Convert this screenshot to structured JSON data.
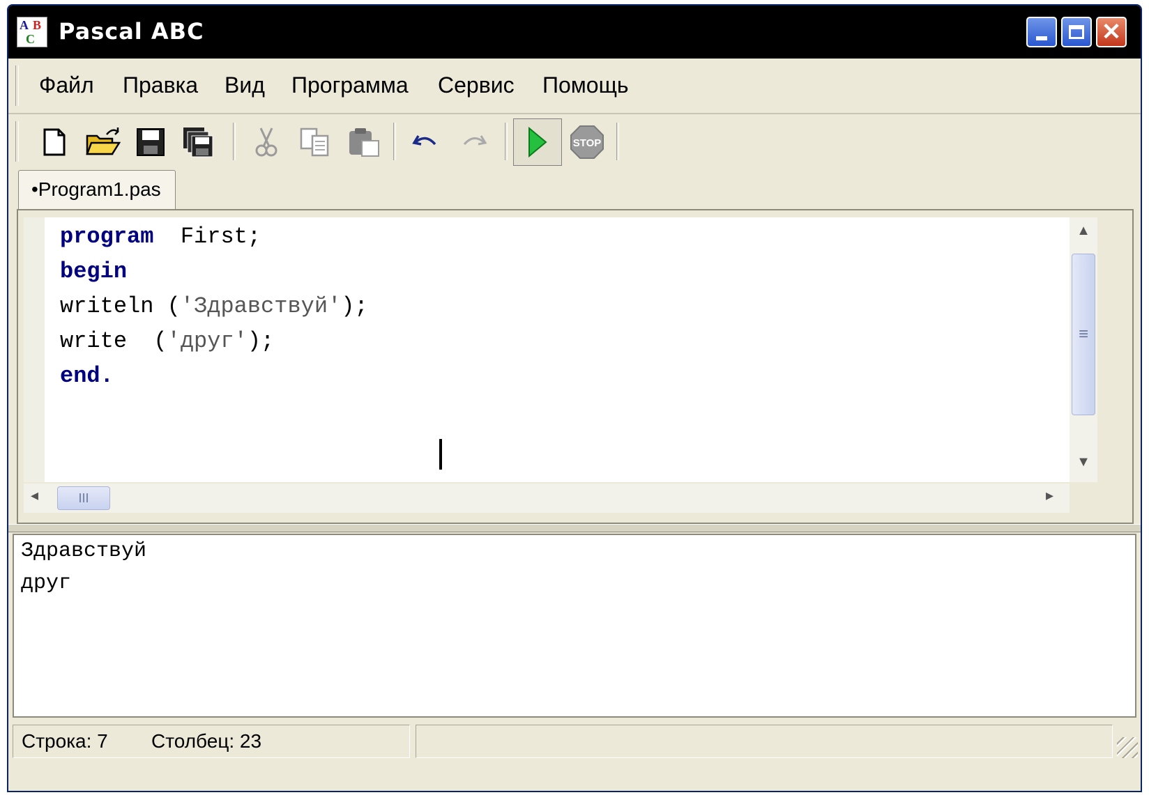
{
  "window": {
    "title": "Pascal ABC",
    "icon_letters": [
      "A",
      "B",
      "C"
    ]
  },
  "menu": {
    "items": [
      "Файл",
      "Правка",
      "Вид",
      "Программа",
      "Сервис",
      "Помощь"
    ]
  },
  "toolbar": {
    "buttons": [
      {
        "name": "new-file",
        "icon": "new-file-icon",
        "enabled": true
      },
      {
        "name": "open-file",
        "icon": "open-folder-icon",
        "enabled": true
      },
      {
        "name": "save",
        "icon": "save-icon",
        "enabled": true
      },
      {
        "name": "save-all",
        "icon": "save-all-icon",
        "enabled": true
      },
      {
        "name": "cut",
        "icon": "scissors-icon",
        "enabled": false
      },
      {
        "name": "copy",
        "icon": "copy-icon",
        "enabled": false
      },
      {
        "name": "paste",
        "icon": "paste-icon",
        "enabled": false
      },
      {
        "name": "undo",
        "icon": "undo-icon",
        "enabled": true
      },
      {
        "name": "redo",
        "icon": "redo-icon",
        "enabled": false
      },
      {
        "name": "run",
        "icon": "play-icon",
        "enabled": true
      },
      {
        "name": "stop",
        "icon": "stop-icon",
        "enabled": false
      }
    ],
    "stop_label": "STOP"
  },
  "tabs": [
    {
      "label": "•Program1.pas",
      "active": true
    }
  ],
  "editor": {
    "lines": [
      {
        "keyword": "program",
        "rest": "  First;"
      },
      {
        "keyword": "begin",
        "rest": ""
      },
      {
        "text": "writeln (",
        "string": "'Здравствуй'",
        "tail": ");"
      },
      {
        "text": "write  (",
        "string": "'друг'",
        "tail": ");"
      },
      {
        "keyword": "end",
        "rest": "."
      }
    ],
    "colors": {
      "keyword": "#000080",
      "string": "#555555"
    }
  },
  "output": {
    "lines": [
      "Здравствуй",
      "друг"
    ]
  },
  "status": {
    "line": "Строка: 7",
    "column": "Столбец: 23"
  },
  "hscroll": {
    "thumb_label": "III"
  },
  "vscroll": {
    "thumb_label": "≡"
  }
}
